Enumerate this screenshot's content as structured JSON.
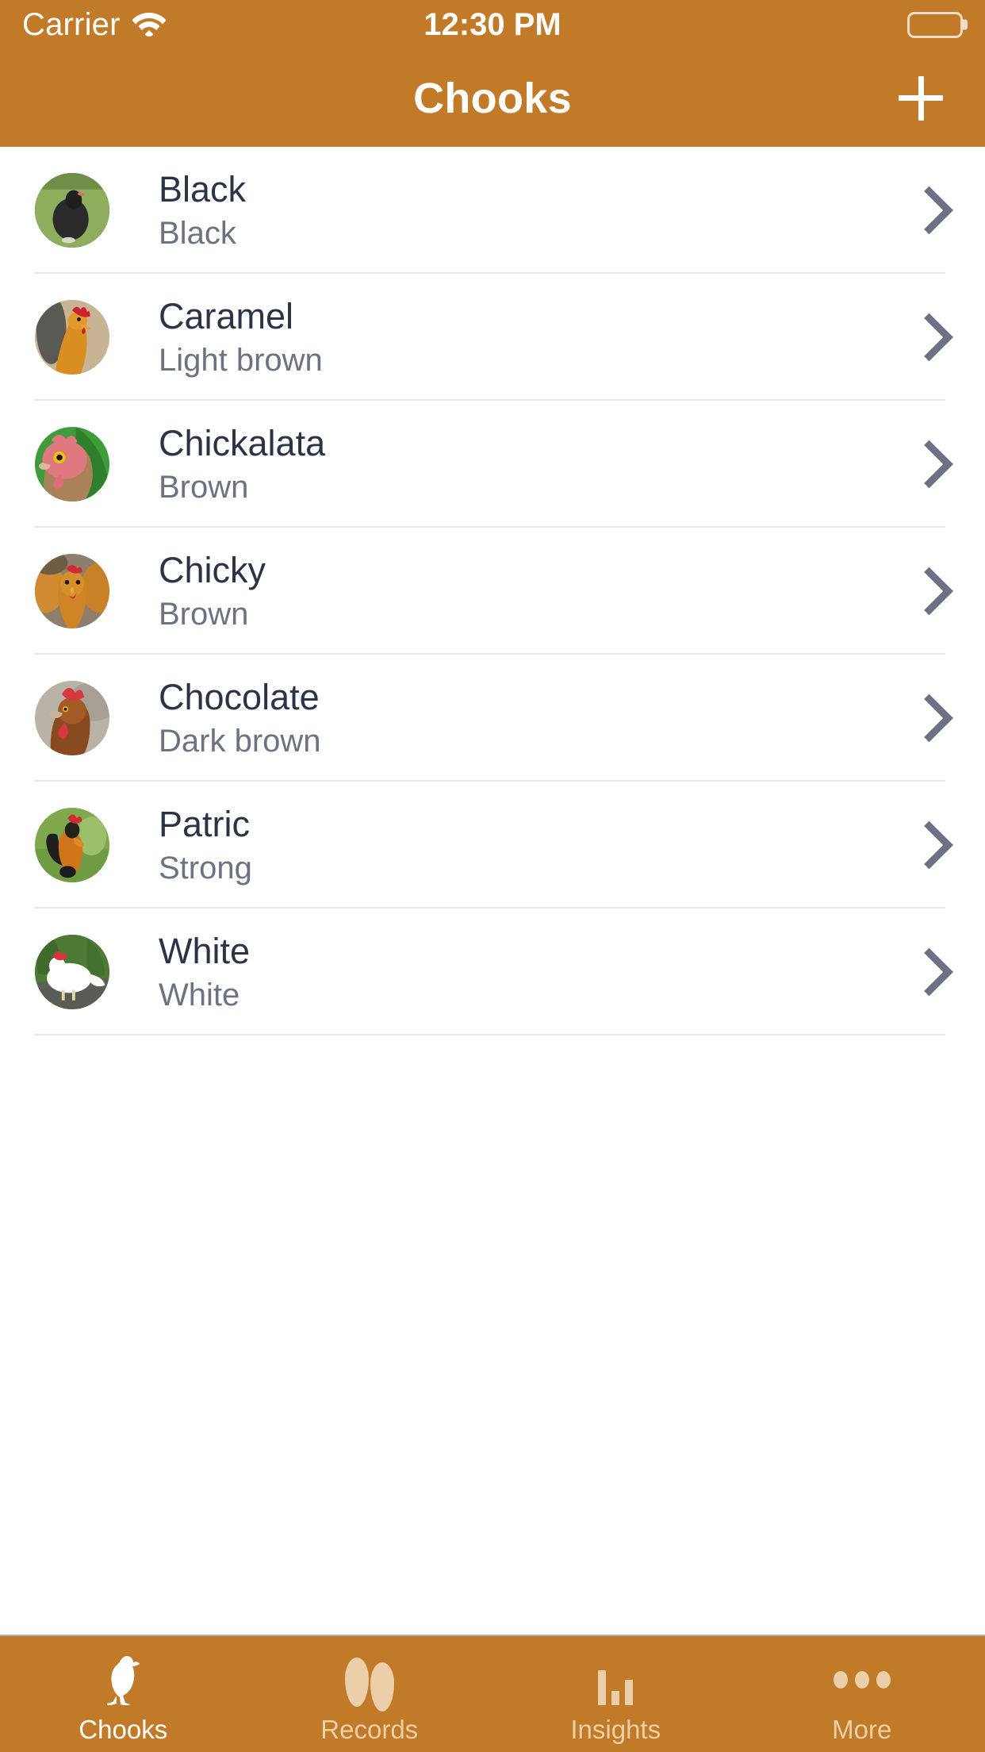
{
  "status_bar": {
    "carrier": "Carrier",
    "wifi_icon": "wifi-icon",
    "time": "12:30 PM",
    "battery_icon": "battery-full-icon"
  },
  "navbar": {
    "title": "Chooks",
    "add_button_icon": "plus-icon",
    "background_color": "#c17a28",
    "title_color": "#ffffff"
  },
  "list": {
    "accessory_icon": "chevron-right-icon",
    "items": [
      {
        "name": "Black",
        "color": "Black",
        "avatar": "chook-photo-black"
      },
      {
        "name": "Caramel",
        "color": "Light brown",
        "avatar": "chook-photo-caramel"
      },
      {
        "name": "Chickalata",
        "color": "Brown",
        "avatar": "chook-photo-chickalata"
      },
      {
        "name": "Chicky",
        "color": "Brown",
        "avatar": "chook-photo-chicky"
      },
      {
        "name": "Chocolate",
        "color": "Dark brown",
        "avatar": "chook-photo-chocolate"
      },
      {
        "name": "Patric",
        "color": "Strong",
        "avatar": "chook-photo-patric"
      },
      {
        "name": "White",
        "color": "White",
        "avatar": "chook-photo-white"
      }
    ]
  },
  "tabbar": {
    "background_color": "#c17a28",
    "active_color": "#ffffff",
    "inactive_color": "#eccfa8",
    "tabs": [
      {
        "label": "Chooks",
        "icon": "chicken-icon",
        "active": true
      },
      {
        "label": "Records",
        "icon": "eggs-icon",
        "active": false
      },
      {
        "label": "Insights",
        "icon": "bar-chart-icon",
        "active": false
      },
      {
        "label": "More",
        "icon": "ellipsis-icon",
        "active": false
      }
    ]
  }
}
